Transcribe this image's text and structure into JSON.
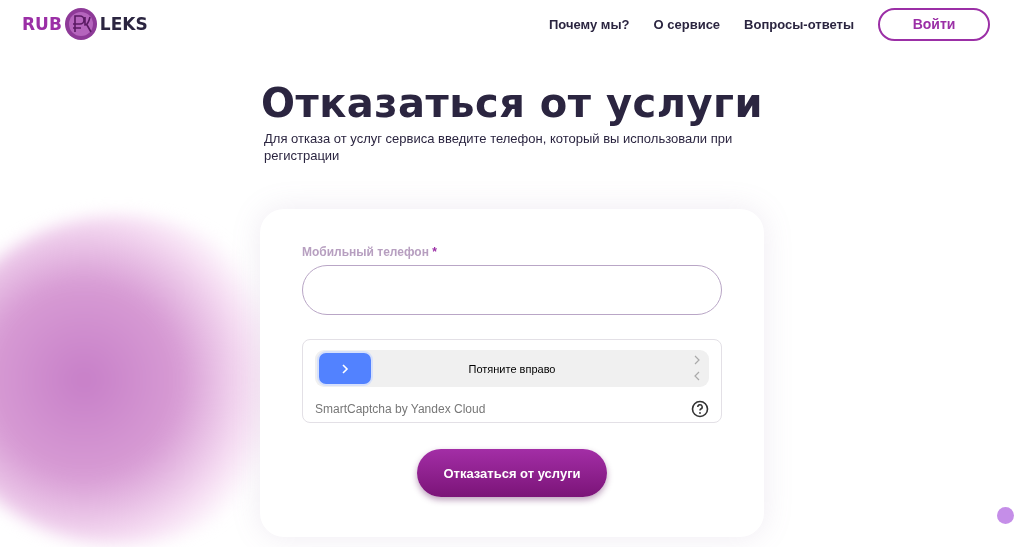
{
  "header": {
    "logo": {
      "left": "RUB",
      "right": "LEKS"
    },
    "nav": [
      "Почему мы?",
      "О сервисе",
      "Вопросы-ответы"
    ],
    "login": "Войти"
  },
  "title": "Отказаться от услуги",
  "subtitle": "Для отказа от услуг сервиса введите телефон, который вы использовали при регистрации",
  "form": {
    "phone_label": "Мобильный телефон",
    "required_mark": "*",
    "captcha": {
      "level": 0,
      "slider_text": "Потяните вправо",
      "brand": "SmartCaptcha by Yandex Cloud"
    },
    "submit": "Отказаться от услуги"
  }
}
